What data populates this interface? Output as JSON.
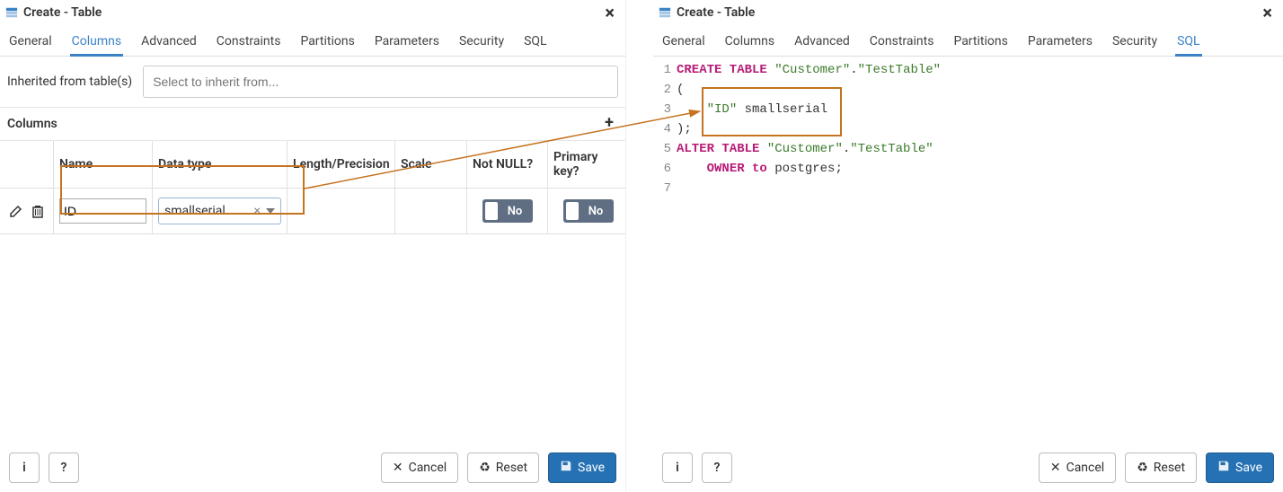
{
  "left": {
    "title": "Create - Table",
    "tabs": [
      "General",
      "Columns",
      "Advanced",
      "Constraints",
      "Partitions",
      "Parameters",
      "Security",
      "SQL"
    ],
    "active_tab": "Columns",
    "inherit_label": "Inherited from table(s)",
    "inherit_placeholder": "Select to inherit from...",
    "columns_title": "Columns",
    "col_headers": [
      "",
      "Name",
      "Data type",
      "Length/Precision",
      "Scale",
      "Not NULL?",
      "Primary key?"
    ],
    "row": {
      "name": "ID",
      "data_type": "smallserial",
      "not_null": "No",
      "primary_key": "No"
    },
    "buttons": {
      "info": "i",
      "help": "?",
      "cancel": "Cancel",
      "reset": "Reset",
      "save": "Save"
    }
  },
  "right": {
    "title": "Create - Table",
    "tabs": [
      "General",
      "Columns",
      "Advanced",
      "Constraints",
      "Partitions",
      "Parameters",
      "Security",
      "SQL"
    ],
    "active_tab": "SQL",
    "sql_lines": [
      {
        "n": 1,
        "parts": [
          [
            "kw",
            "CREATE TABLE"
          ],
          [
            "tok",
            " "
          ],
          [
            "str",
            "\"Customer\""
          ],
          [
            "tok",
            "."
          ],
          [
            "str",
            "\"TestTable\""
          ]
        ]
      },
      {
        "n": 2,
        "parts": [
          [
            "tok",
            "("
          ]
        ]
      },
      {
        "n": 3,
        "parts": [
          [
            "tok",
            "    "
          ],
          [
            "str",
            "\"ID\""
          ],
          [
            "tok",
            " "
          ],
          [
            "ident",
            "smallserial"
          ]
        ]
      },
      {
        "n": 4,
        "parts": [
          [
            "tok",
            ");"
          ]
        ]
      },
      {
        "n": 5,
        "parts": [
          [
            "tok",
            ""
          ]
        ]
      },
      {
        "n": 6,
        "parts": [
          [
            "kw",
            "ALTER TABLE"
          ],
          [
            "tok",
            " "
          ],
          [
            "str",
            "\"Customer\""
          ],
          [
            "tok",
            "."
          ],
          [
            "str",
            "\"TestTable\""
          ]
        ]
      },
      {
        "n": 7,
        "parts": [
          [
            "tok",
            "    "
          ],
          [
            "kw",
            "OWNER to"
          ],
          [
            "tok",
            " postgres;"
          ]
        ]
      }
    ],
    "buttons": {
      "info": "i",
      "help": "?",
      "cancel": "Cancel",
      "reset": "Reset",
      "save": "Save"
    }
  }
}
